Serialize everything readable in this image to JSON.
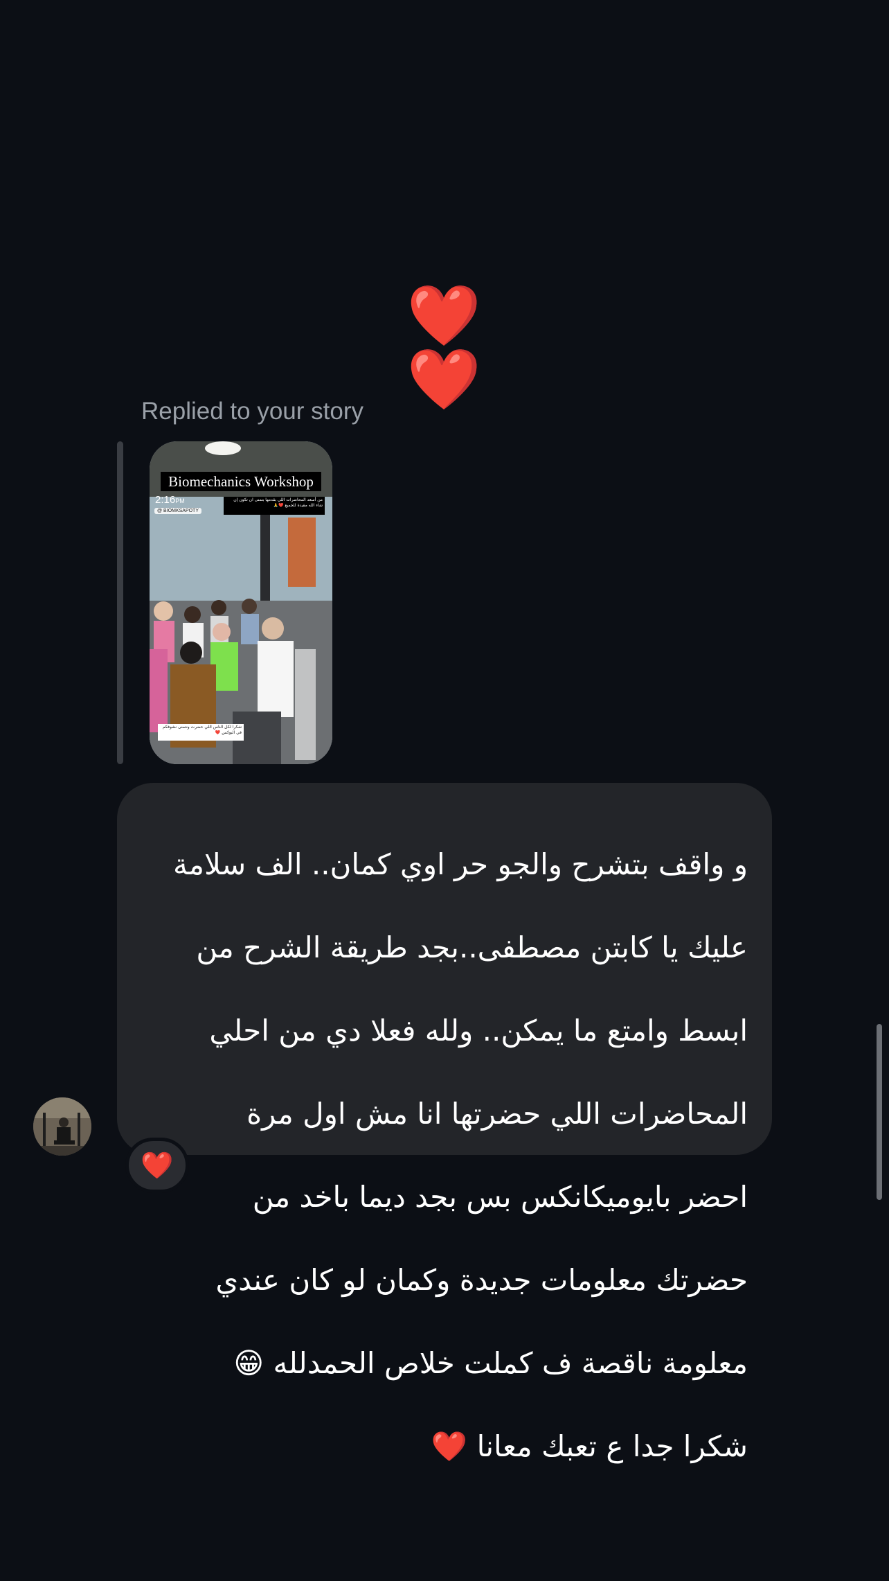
{
  "colors": {
    "background": "#0c0f15",
    "bubble": "#232529",
    "reply_label": "#9aa0a8",
    "heart": "#e0191e"
  },
  "hearts_message": {
    "text": "❤️❤️",
    "icon": "red-heart-emoji"
  },
  "reply": {
    "label": "Replied to your story",
    "story": {
      "title": "Biomechanics Workshop",
      "time": "2:16",
      "time_suffix": "PM",
      "handle": "@ BIOMKSAPOTY",
      "top_caption": "من أسعد المحاضرات اللي بقدمها بتمنى ان تكون إن شاء الله مفيدة للجميع ❤️🙏",
      "bottom_caption": "شكرا لكل الناس اللي حضرت ونتمنى نشوفكم في البوكس ❤️"
    }
  },
  "message": {
    "lines": [
      "و واقف بتشرح والجو حر اوي كمان.. الف سلامة",
      "عليك يا كابتن مصطفى..بجد طريقة الشرح من",
      "ابسط وامتع ما يمكن.. ولله فعلا دي من احلي",
      "المحاضرات اللي حضرتها انا مش اول مرة",
      "احضر بايوميكانكس بس بجد ديما باخد من",
      "حضرتك معلومات جديدة وكمان لو كان عندي",
      "معلومة ناقصة ف كملت خلاص الحمدلله 😁",
      "شكرا جدا ع تعبك معانا  ❤️"
    ]
  },
  "reaction": {
    "emoji": "❤️",
    "icon": "heart-reaction"
  },
  "avatar": {
    "icon": "sender-avatar"
  }
}
